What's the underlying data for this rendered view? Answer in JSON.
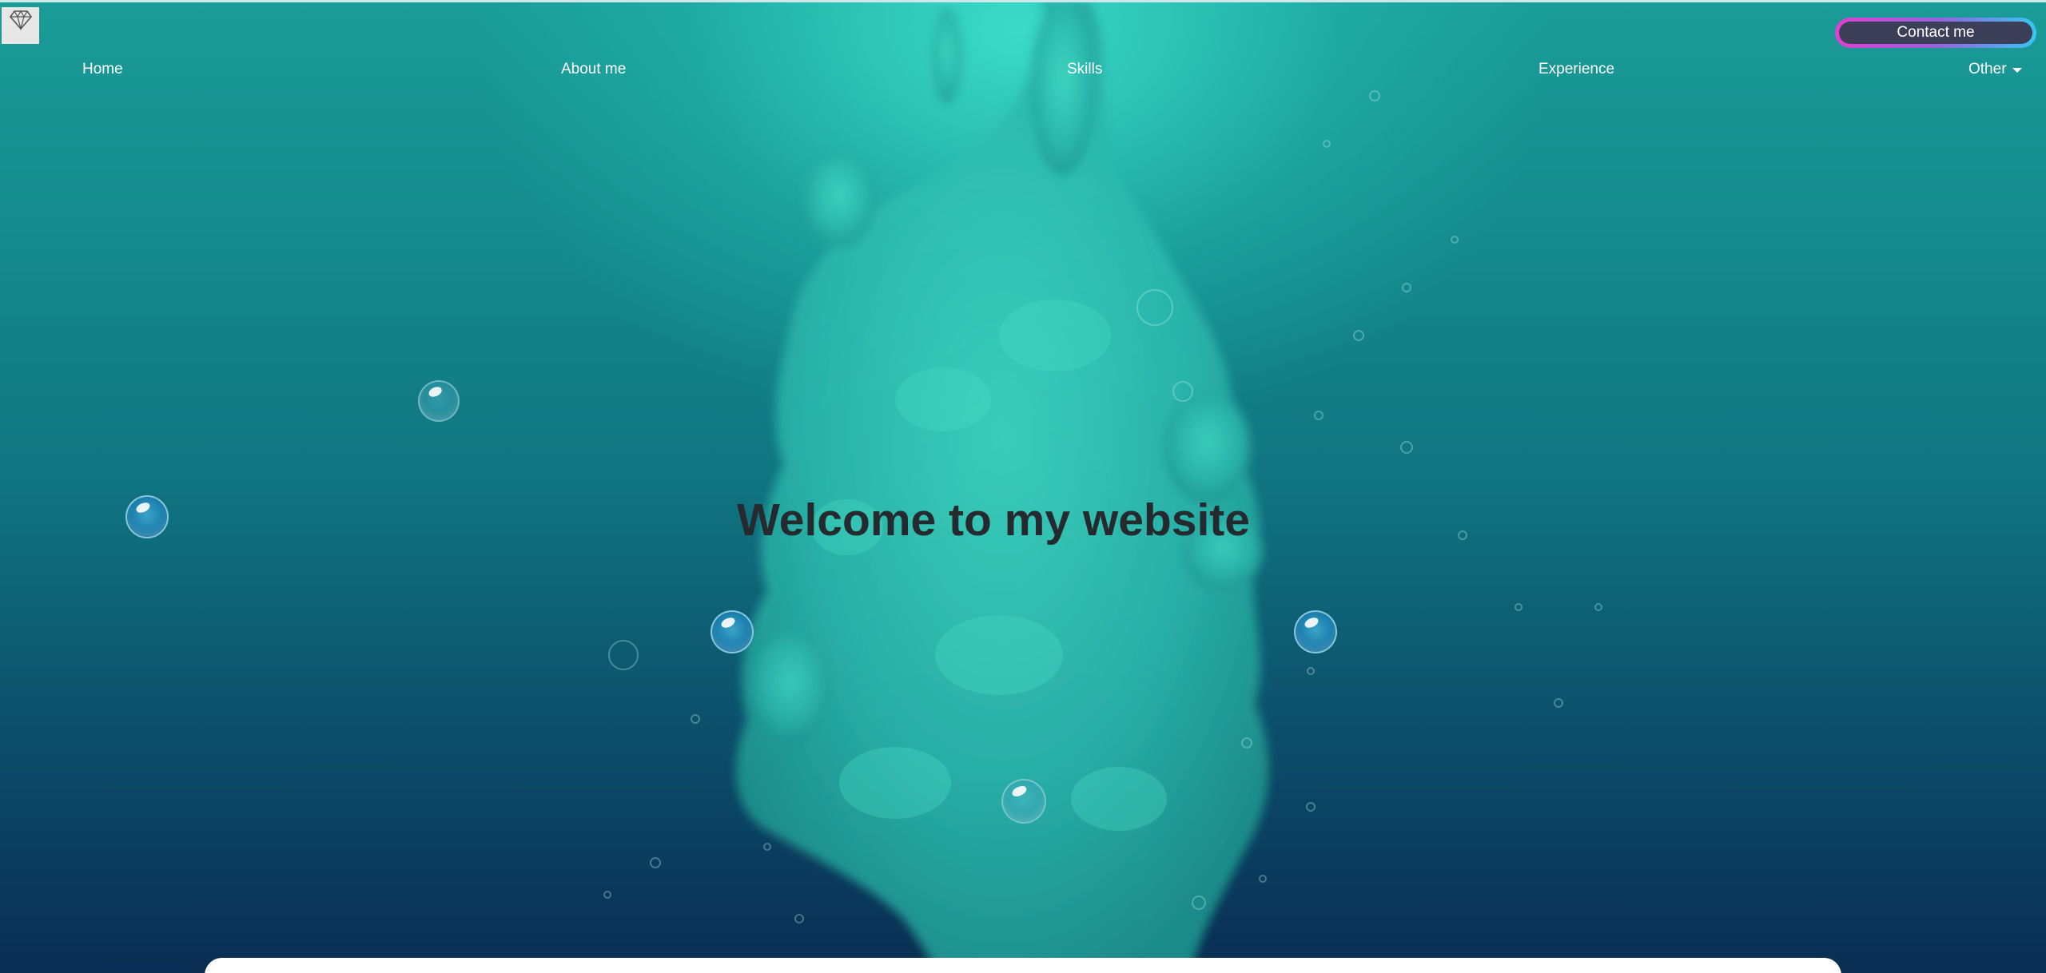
{
  "nav": {
    "items": [
      {
        "label": "Home"
      },
      {
        "label": "About me"
      },
      {
        "label": "Skills"
      },
      {
        "label": "Experience"
      },
      {
        "label": "Other"
      }
    ],
    "contact_label": "Contact me"
  },
  "logo": {
    "icon": "diamond-icon"
  },
  "hero": {
    "headline": "Welcome to my website"
  },
  "colors": {
    "accent_gradient_start": "#e23fd0",
    "accent_gradient_end": "#37c6f0",
    "button_fill": "#3b3f57",
    "headline_color": "#242a2d"
  }
}
